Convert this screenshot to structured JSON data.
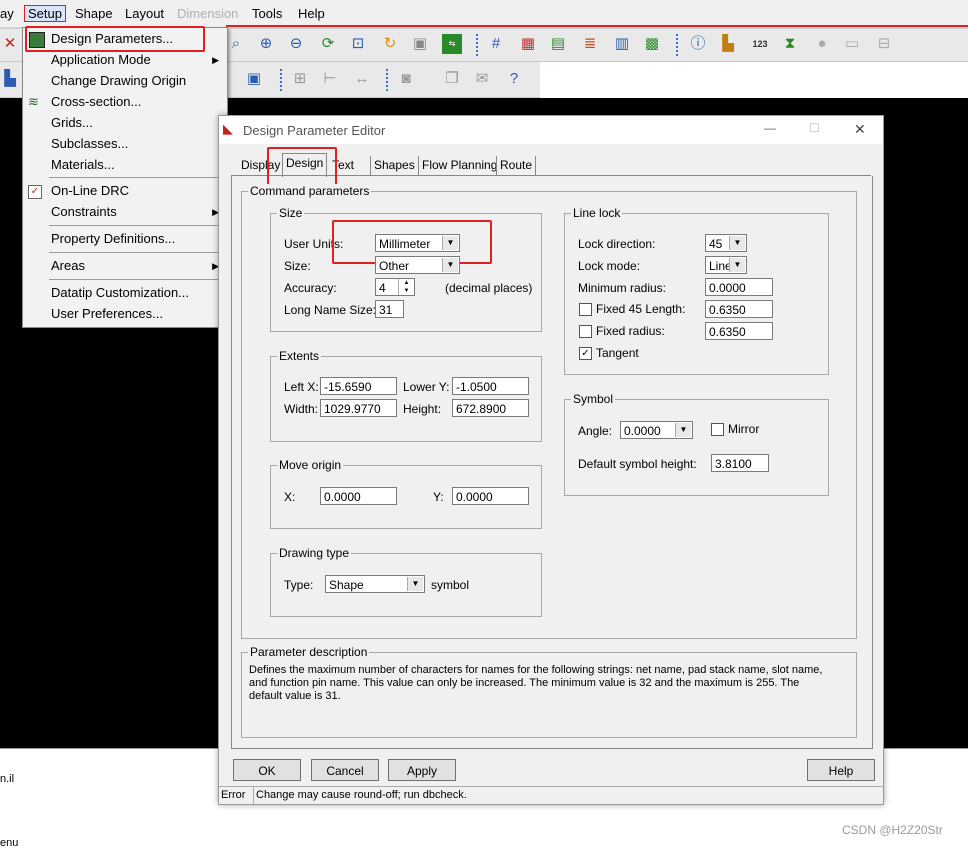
{
  "menubar": {
    "items": [
      "ay",
      "Setup",
      "Shape",
      "Layout",
      "Dimension",
      "Tools",
      "Help"
    ]
  },
  "toolbar_icons": [
    "close-x-icon",
    "zoom-points-icon",
    "zoom-in-icon",
    "zoom-out-icon",
    "zoom-world-icon",
    "zoom-fit-icon",
    "refresh-icon",
    "3d-view-icon",
    "flip-icon",
    "grid-icon",
    "color-icon",
    "layers-icon",
    "stackup-icon",
    "icm-icon",
    "shadow-icon",
    "info-icon",
    "measure-icon",
    "numbers-icon",
    "hourglass-icon",
    "gear-icon",
    "disabled-icon",
    "disabled2-icon"
  ],
  "toolbar2_icons": [
    "panel-icon",
    "panel2-icon",
    "lock-icon",
    "dim-icon",
    "dim2-icon",
    "camera-icon",
    "stack-icon",
    "mail-icon",
    "help-icon"
  ],
  "setup_menu": {
    "items": [
      {
        "label": "Design Parameters...",
        "icon": "design-params-icon"
      },
      {
        "label": "Application Mode",
        "submenu": "▶"
      },
      {
        "label": "Change Drawing Origin"
      },
      {
        "label": "Cross-section...",
        "icon": "cross-section-icon"
      },
      {
        "label": "Grids..."
      },
      {
        "label": "Subclasses..."
      },
      {
        "label": "Materials..."
      },
      {
        "label": "On-Line DRC",
        "checked": "✓"
      },
      {
        "label": "Constraints",
        "submenu": "▶"
      },
      {
        "label": "Property Definitions..."
      },
      {
        "label": "Areas",
        "submenu": "▶"
      },
      {
        "label": "Datatip Customization..."
      },
      {
        "label": "User Preferences..."
      }
    ]
  },
  "dialog": {
    "title": "Design Parameter Editor",
    "tabs": [
      "Display",
      "Design",
      "Text",
      "Shapes",
      "Flow Planning",
      "Route"
    ],
    "command_params_label": "Command parameters",
    "size": {
      "title": "Size",
      "user_units_label": "User Units:",
      "user_units_value": "Millimeter",
      "size_label": "Size:",
      "size_value": "Other",
      "accuracy_label": "Accuracy:",
      "accuracy_value": "4",
      "accuracy_note": "(decimal places)",
      "long_name_label": "Long Name Size:",
      "long_name_value": "31"
    },
    "extents": {
      "title": "Extents",
      "left_x_label": "Left X:",
      "left_x": "-15.6590",
      "lower_y_label": "Lower Y:",
      "lower_y": "-1.0500",
      "width_label": "Width:",
      "width": "1029.9770",
      "height_label": "Height:",
      "height": "672.8900"
    },
    "move_origin": {
      "title": "Move origin",
      "x_label": "X:",
      "x": "0.0000",
      "y_label": "Y:",
      "y": "0.0000"
    },
    "drawing_type": {
      "title": "Drawing type",
      "type_label": "Type:",
      "type_value": "Shape",
      "suffix": "symbol"
    },
    "line_lock": {
      "title": "Line lock",
      "lock_direction_label": "Lock direction:",
      "lock_direction": "45",
      "lock_mode_label": "Lock mode:",
      "lock_mode": "Line",
      "min_radius_label": "Minimum radius:",
      "min_radius": "0.0000",
      "fixed45_label": "Fixed 45 Length:",
      "fixed45": "0.6350",
      "fixed_radius_label": "Fixed radius:",
      "fixed_radius": "0.6350",
      "tangent_label": "Tangent",
      "tangent_check": "✓"
    },
    "symbol": {
      "title": "Symbol",
      "angle_label": "Angle:",
      "angle": "0.0000",
      "mirror_label": "Mirror",
      "default_height_label": "Default symbol height:",
      "default_height": "3.8100"
    },
    "param_desc": {
      "title": "Parameter description",
      "text": "Defines the maximum number of characters for names for the following strings: net name, pad stack name, slot name, and function pin name.  This value can only be increased.  The minimum value is 32 and the maximum is 255.  The default value is 31."
    },
    "buttons": {
      "ok": "OK",
      "cancel": "Cancel",
      "apply": "Apply",
      "help": "Help"
    },
    "status": {
      "level": "Error",
      "message": "Change may cause round-off; run dbcheck."
    },
    "dropdown_arrow": "▼",
    "spin_up": "▲",
    "spin_down": "▼",
    "close_glyph": "✕",
    "min_glyph": "—",
    "max_glyph": "☐"
  },
  "console": {
    "line1": "n.il",
    "line2": "enu"
  },
  "watermark": "CSDN @H2Z20Str",
  "colors": {
    "highlight": "#e02020",
    "menubar_line": "#e0201f",
    "canvas": "#000000"
  }
}
